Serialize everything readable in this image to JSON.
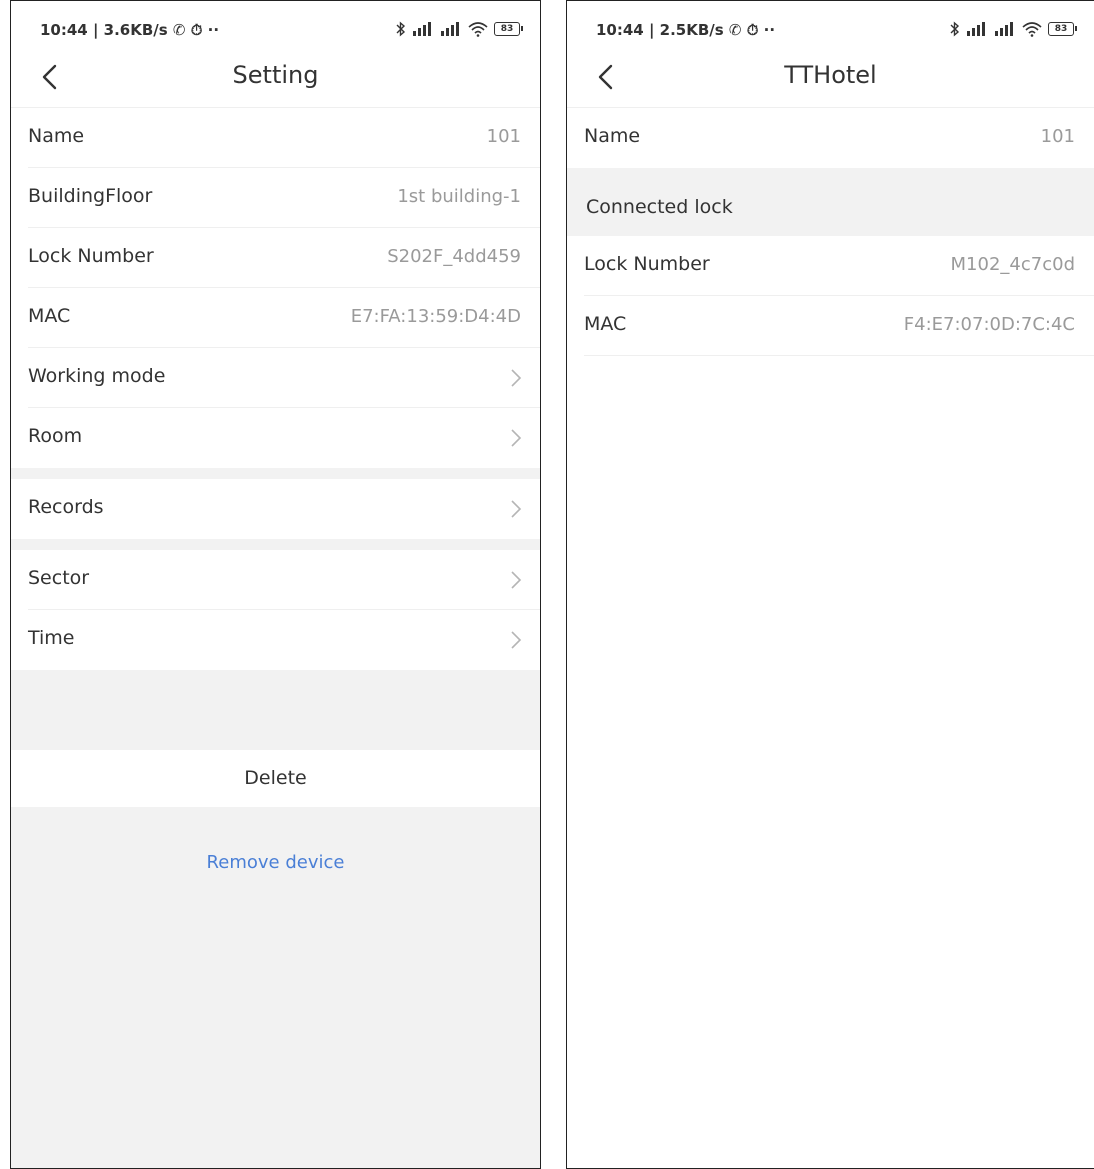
{
  "left_screen": {
    "status": {
      "time": "10:44 | 3.6KB/s ✆ ⏱ ··",
      "battery": "83"
    },
    "nav": {
      "title": "Setting"
    },
    "rows_group1": [
      {
        "label": "Name",
        "value": "101"
      },
      {
        "label": "BuildingFloor",
        "value": "1st building-1"
      },
      {
        "label": "Lock Number",
        "value": "S202F_4dd459"
      },
      {
        "label": "MAC",
        "value": "E7:FA:13:59:D4:4D"
      },
      {
        "label": "Working mode"
      },
      {
        "label": "Room"
      }
    ],
    "rows_group2": [
      {
        "label": "Records"
      }
    ],
    "rows_group3": [
      {
        "label": "Sector"
      },
      {
        "label": "Time"
      }
    ],
    "delete_label": "Delete",
    "remove_label": "Remove device"
  },
  "right_screen": {
    "status": {
      "time": "10:44 | 2.5KB/s ✆ ⏱ ··",
      "battery": "83"
    },
    "nav": {
      "title": "TTHotel"
    },
    "name_row": {
      "label": "Name",
      "value": "101"
    },
    "section_label": "Connected lock",
    "lock_rows": [
      {
        "label": "Lock Number",
        "value": "M102_4c7c0d"
      },
      {
        "label": "MAC",
        "value": "F4:E7:07:0D:7C:4C"
      }
    ]
  }
}
